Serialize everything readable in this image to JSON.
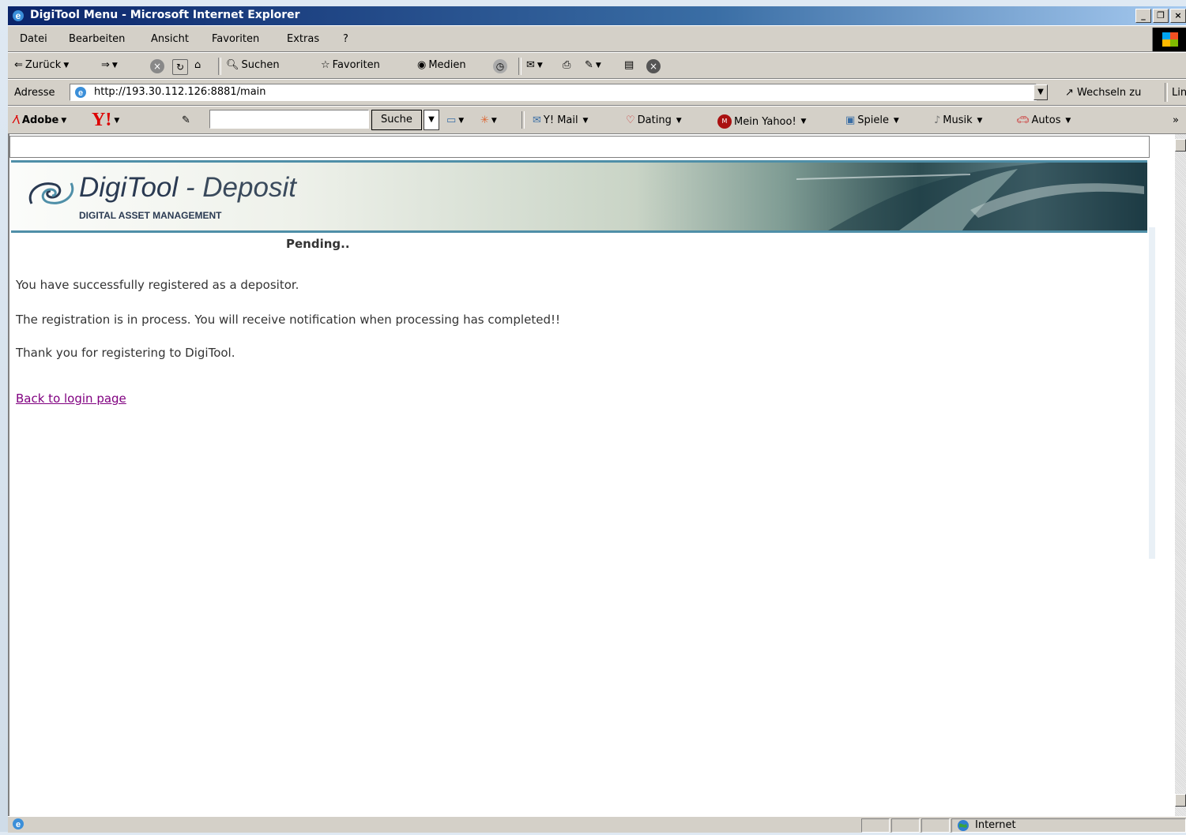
{
  "window": {
    "title": "DigiTool Menu - Microsoft Internet Explorer"
  },
  "menu": [
    "Datei",
    "Bearbeiten",
    "Ansicht",
    "Favoriten",
    "Extras",
    "?"
  ],
  "toolbar": {
    "back": "Zurück",
    "search": "Suchen",
    "favorites": "Favoriten",
    "media": "Medien"
  },
  "address": {
    "label": "Adresse",
    "url": "http://193.30.112.126:8881/main",
    "go": "Wechseln zu",
    "links": "Link"
  },
  "yahoo": {
    "adobe": "Adobe",
    "search_button": "Suche",
    "search_value": "",
    "mail": "Y! Mail",
    "dating": "Dating",
    "mein": "Mein Yahoo!",
    "spiele": "Spiele",
    "musik": "Musik",
    "autos": "Autos",
    "more": "»"
  },
  "banner": {
    "brand": "DigiTool",
    "separator": " - ",
    "product": "Deposit",
    "subtitle": "DIGITAL ASSET MANAGEMENT"
  },
  "page": {
    "status_heading": "Pending..",
    "message1": "You have successfully registered as a depositor.",
    "message2": "The registration is in process. You will receive notification when processing has completed!!",
    "message3": "Thank you for registering to DigiTool.",
    "back_link": "Back to login page"
  },
  "statusbar": {
    "zone": "Internet"
  },
  "colors": {
    "titlebar": "#0a246a",
    "chrome": "#d4d0c8",
    "banner_border": "#4f8fa8",
    "visited_link": "#800080"
  }
}
